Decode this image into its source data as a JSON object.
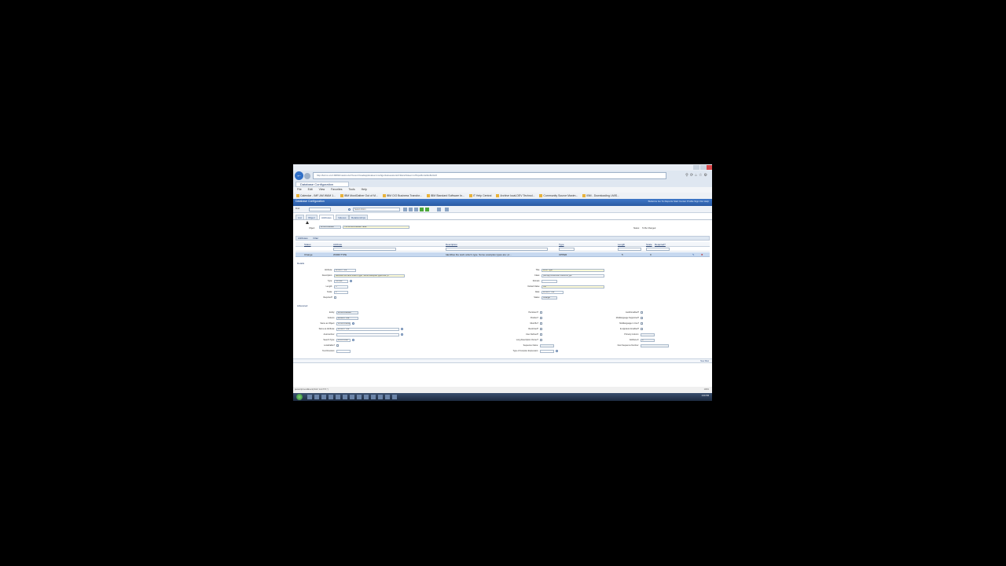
{
  "browser": {
    "url": "http://lwmx-srv1:9080/maximo/ui/?event=loadapp&value=configur&uisessionid=3&csrftoken=uf7kpsl6mts0kv8n0s3f",
    "tab_title": "Database Configuration",
    "menu": [
      "File",
      "Edit",
      "View",
      "Favorites",
      "Tools",
      "Help"
    ],
    "favorites": [
      "Calendar - IMF-AM WAM 1...",
      "IBM MustGather Out of M...",
      "IBM CIO Business Transfor...",
      "IBM Standard Software In...",
      "IT Help Central",
      "Archive local-DEV Technol...",
      "Community Source Maxim...",
      "IBM - Downloading LMIS..."
    ]
  },
  "app": {
    "header_title": "Database Configuration",
    "header_links": "Bulletins  Go To  Reports  Start Center  Profile  Sign Out  Help"
  },
  "toolbar": {
    "find_label": "Find:",
    "select_action": "Select Action"
  },
  "tabs": [
    "List",
    "Object",
    "Attributes",
    "Indexes",
    "Relationships"
  ],
  "object": {
    "label": "Object:",
    "value": "WORKORDER",
    "description": "The WORKORDER Table",
    "status_label": "Status:",
    "status_value": "To Be Changed"
  },
  "attributes_section": {
    "title": "Attributes",
    "filter_label": "Filter",
    "columns": [
      "Status",
      "Attribute",
      "Description",
      "Type",
      "Length",
      "Scale",
      "Required?"
    ],
    "row": {
      "status": "Change",
      "attribute": "WORKTYPE",
      "description": "Identifies the work order's type. Some examples types are: pr...",
      "type": "UPPER",
      "length": "5",
      "scale": "0"
    }
  },
  "details": {
    "title": "Details",
    "left": [
      {
        "label": "Attribute:",
        "value": "WORKTYPE"
      },
      {
        "label": "Description:",
        "value": "Identifies the work order's type. Some examples types are: pr"
      },
      {
        "label": "Type:",
        "value": "UPPER"
      },
      {
        "label": "Length:",
        "value": "5"
      },
      {
        "label": "Scale:",
        "value": "0"
      },
      {
        "label": "Required?",
        "value": ""
      }
    ],
    "right": [
      {
        "label": "Title:",
        "value": "Work Type"
      },
      {
        "label": "Class:",
        "value": "psdi.app.workorder.FldWorkType"
      },
      {
        "label": "Domain:",
        "value": ""
      },
      {
        "label": "Default Value:",
        "value": "CM"
      },
      {
        "label": "Alias:",
        "value": "WORKTYPE"
      },
      {
        "label": "Status:",
        "value": "Change"
      }
    ]
  },
  "advanced": {
    "title": "Advanced",
    "col1": [
      {
        "label": "Entity:",
        "value": "WORKORDER"
      },
      {
        "label": "Column:",
        "value": "WORKTYPE"
      },
      {
        "label": "Same as Object:",
        "value": "WORKORDER"
      },
      {
        "label": "Same as Attribute:",
        "value": "WORKTYPE"
      },
      {
        "label": "Autonumber:",
        "value": ""
      },
      {
        "label": "Search Type:",
        "value": "WILDCARD"
      },
      {
        "label": "Localizable?",
        "value": ""
      },
      {
        "label": "Text Direction:",
        "value": ""
      }
    ],
    "col2": [
      {
        "label": "Persistent?",
        "value": ""
      },
      {
        "label": "Positive?",
        "value": ""
      },
      {
        "label": "Must Be?",
        "value": ""
      },
      {
        "label": "Restricted?",
        "value": ""
      },
      {
        "label": "User Defined?",
        "value": ""
      },
      {
        "label": "Long Description Owner?",
        "value": ""
      },
      {
        "label": "Sequence Name:",
        "value": ""
      },
      {
        "label": "Type of Complex Expression:",
        "value": ""
      }
    ],
    "col3": [
      {
        "label": "Audit Enabled?",
        "value": ""
      },
      {
        "label": "Multilanguage Supported?",
        "value": ""
      },
      {
        "label": "Multilanguage in Use?",
        "value": ""
      },
      {
        "label": "E-signature Enabled?",
        "value": ""
      },
      {
        "label": "Primary Column:",
        "value": ""
      },
      {
        "label": "Attribute #:",
        "value": "8"
      },
      {
        "label": "Next Sequence Number:",
        "value": ""
      }
    ]
  },
  "bottom_button": "New Row",
  "statusbar": {
    "text": "javascript:sendEvent('click','mx1773','')",
    "zoom": "100%"
  },
  "taskbar": {
    "tray_time": "4:40 PM"
  }
}
